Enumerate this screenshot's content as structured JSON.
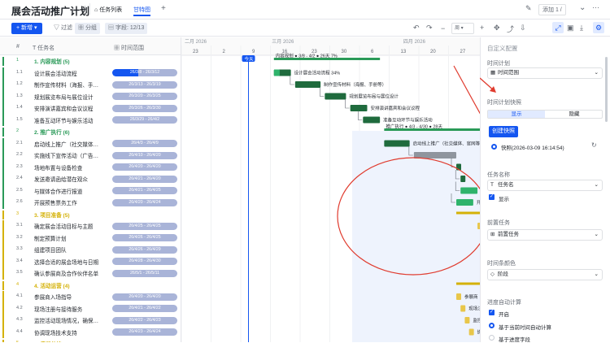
{
  "app": {
    "title": "展会活动推广计划",
    "star": "☆"
  },
  "tabs": [
    {
      "label": "任务列表"
    },
    {
      "label": "甘特图"
    }
  ],
  "top_actions": {
    "add": "添加 1 /"
  },
  "toolbar": {
    "new": "新增",
    "filter": "过滤",
    "group": "分组",
    "fields": "字段: 12/13"
  },
  "columns": {
    "num": "#",
    "name": "任务名",
    "time": "时间范围"
  },
  "timeline": {
    "months": [
      "二月 2026",
      "三月 2026",
      "四月 2026"
    ],
    "days": [
      "23",
      "2",
      "9",
      "16",
      "23",
      "30",
      "6",
      "13",
      "20",
      "27"
    ],
    "today": "今天"
  },
  "groups": [
    {
      "num": "1",
      "name": "1. 内容规划",
      "count": "(5)",
      "color": "#2a9a58",
      "summary": "3/8 - 4/2",
      "dur": "26天",
      "pct": "7%",
      "tasks": [
        {
          "num": "1.1",
          "name": "设计展会活动流程",
          "time": "26/3/8 - 26/3/12",
          "label": "设计展会活动流程 34%",
          "progress": 34
        },
        {
          "num": "1.2",
          "name": "制作宣传材料（海报、手…",
          "time": "26/3/13 - 26/3/19",
          "label": "制作宣传材料（海报、手册等）",
          "progress": 0
        },
        {
          "num": "1.3",
          "name": "规划展览布局与展位设计",
          "time": "26/3/20 - 26/3/25",
          "label": "规划展览布局与展位设计",
          "progress": 0
        },
        {
          "num": "1.4",
          "name": "安排演讲嘉宾和会议议程",
          "time": "26/3/26 - 26/3/30",
          "label": "安排演讲嘉宾和会议议程",
          "progress": 0
        },
        {
          "num": "1.5",
          "name": "准备互动环节与娱乐活动",
          "time": "26/3/29 - 26/4/2",
          "label": "准备互动环节与娱乐活动",
          "progress": 0
        }
      ]
    },
    {
      "num": "2",
      "name": "2. 推广执行",
      "count": "(6)",
      "color": "#2a9a58",
      "summary": "4/3 - 4/30",
      "dur": "28天",
      "pct": "",
      "tasks": [
        {
          "num": "2.1",
          "name": "启动线上推广（社交媒体…",
          "time": "26/4/3 - 26/4/9",
          "label": "启动线上推广（社交媒体、官网等）",
          "progress": 0
        },
        {
          "num": "2.2",
          "name": "实施线下宣传活动（广告…",
          "time": "26/4/10 - 26/4/20",
          "label": "",
          "progress": 0
        },
        {
          "num": "2.3",
          "name": "场地布置与设备检查",
          "time": "26/4/20 - 26/4/20",
          "label": "",
          "progress": 0
        },
        {
          "num": "2.4",
          "name": "发送邀请函给潜在观众",
          "time": "26/4/21 - 26/4/20",
          "label": "",
          "progress": 0
        },
        {
          "num": "2.5",
          "name": "与媒体合作进行报道",
          "time": "26/4/21 - 26/4/25",
          "label": "与媒体合作进",
          "progress": 0
        },
        {
          "num": "2.6",
          "name": "开展预售票务工作",
          "time": "26/4/20 - 26/4/24",
          "label": "开展预",
          "progress": 0
        }
      ]
    },
    {
      "num": "3",
      "name": "3. 项目准备",
      "count": "(5)",
      "color": "#d4b106",
      "summary": "",
      "dur": "",
      "pct": "",
      "tasks": [
        {
          "num": "3.1",
          "name": "确定展会活动目标与主题",
          "time": "26/4/25 - 26/4/25",
          "label": "项目",
          "progress": 0
        },
        {
          "num": "3.2",
          "name": "制定预算计划",
          "time": "26/4/26 - 26/4/25",
          "label": "",
          "progress": 0
        },
        {
          "num": "3.3",
          "name": "组建项目团队",
          "time": "26/4/26 - 26/4/29",
          "label": "",
          "progress": 0
        },
        {
          "num": "3.4",
          "name": "选择合适的展会场地与日期",
          "time": "26/4/28 - 26/4/30",
          "label": "",
          "progress": 0
        },
        {
          "num": "3.5",
          "name": "确认参展商及合作伙伴名单",
          "time": "26/5/1 - 26/5/11",
          "label": "",
          "progress": 0
        }
      ]
    },
    {
      "num": "4",
      "name": "4. 活动运营",
      "count": "(4)",
      "color": "#d4b106",
      "summary": "",
      "dur": "",
      "pct": "",
      "tasks": [
        {
          "num": "4.1",
          "name": "参展商入场指导",
          "time": "26/4/20 - 26/4/20",
          "label": "参展商",
          "progress": 0
        },
        {
          "num": "4.2",
          "name": "现场注册与接待服务",
          "time": "26/4/21 - 26/4/22",
          "label": "现场注册",
          "progress": 0
        },
        {
          "num": "4.3",
          "name": "监控活动现场情况，确保…",
          "time": "26/4/22 - 26/4/23",
          "label": "监控活",
          "progress": 0
        },
        {
          "num": "4.4",
          "name": "协调现场技术支持",
          "time": "26/4/23 - 26/4/24",
          "label": "协",
          "progress": 0
        }
      ]
    },
    {
      "num": "5",
      "name": "5. 后期总结",
      "count": "(4)",
      "color": "#d4b106",
      "summary": "",
      "dur": "",
      "pct": "",
      "tasks": []
    }
  ],
  "panel": {
    "title": "自定义配置",
    "time_plan_label": "时间计划",
    "time_plan_value": "时间范围",
    "snapshot_label": "时间计划快照",
    "seg_show": "显示",
    "seg_hide": "隐藏",
    "create_snapshot": "创建快照",
    "snapshot_item": "快照(2026-03-09 16:14:54)",
    "task_name_label": "任务名称",
    "task_name_value": "任务名",
    "show_label": "显示",
    "pre_task_label": "前置任务",
    "pre_task_value": "前置任务",
    "bar_color_label": "时间条颜色",
    "bar_color_value": "阶段",
    "auto_calc_label": "进度自动计算",
    "enable_label": "开启",
    "opt1": "基于当前时间自动计算",
    "opt2": "基于进度字段"
  },
  "colors": {
    "accent": "#1456f0",
    "green": "#2a9a58",
    "dark_green": "#1f6b3d",
    "yellow": "#d4b106",
    "pill": "#a9b4d8",
    "red": "#e03b2e"
  }
}
